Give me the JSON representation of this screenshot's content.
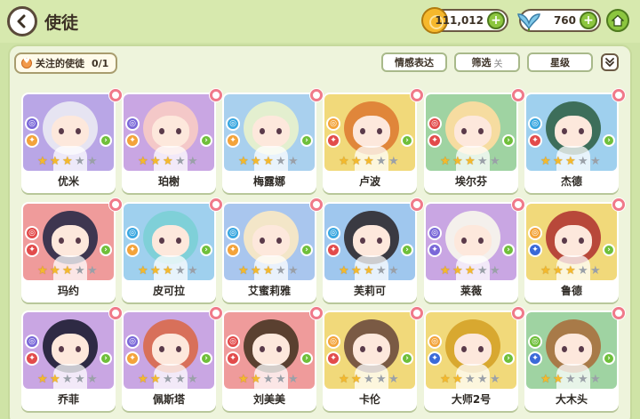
{
  "header": {
    "title": "使徒"
  },
  "currency": {
    "coins": "111,012",
    "gems": "760"
  },
  "toolbar": {
    "follow_label": "关注的使徒",
    "follow_count": "0/1",
    "emotion_label": "情感表达",
    "filter_label": "筛选",
    "filter_state": "关",
    "star_label": "星级"
  },
  "rows": [
    [
      {
        "name": "优米",
        "bg": "#b9a6e6",
        "stars": 3,
        "element": "#7a68d8",
        "role": "#f3a33a",
        "hair": "#e6e4f2"
      },
      {
        "name": "珀榭",
        "bg": "#c9a6e3",
        "stars": 3,
        "element": "#7a68d8",
        "role": "#f3a33a",
        "hair": "#f4c8c8"
      },
      {
        "name": "梅露娜",
        "bg": "#a9d0ee",
        "stars": 3,
        "element": "#3aa7e0",
        "role": "#f3a33a",
        "hair": "#e3efcf"
      },
      {
        "name": "卢波",
        "bg": "#f1d97a",
        "stars": 3,
        "element": "#f3a33a",
        "role": "#e24b4b",
        "hair": "#e0863a"
      },
      {
        "name": "埃尔芬",
        "bg": "#9fd3a2",
        "stars": 3,
        "element": "#e24b4b",
        "role": "#e24b4b",
        "hair": "#f6dca0"
      },
      {
        "name": "杰德",
        "bg": "#9fd0ee",
        "stars": 3,
        "element": "#3aa7e0",
        "role": "#e24b4b",
        "hair": "#3d6e5a"
      }
    ],
    [
      {
        "name": "玛约",
        "bg": "#ef9b9b",
        "stars": 3,
        "element": "#e24b4b",
        "role": "#e24b4b",
        "hair": "#3e3650"
      },
      {
        "name": "皮可拉",
        "bg": "#9fd0ee",
        "stars": 3,
        "element": "#3aa7e0",
        "role": "#f3a33a",
        "hair": "#7fd0d8"
      },
      {
        "name": "艾蜜莉雅",
        "bg": "#a9c6ee",
        "stars": 3,
        "element": "#3aa7e0",
        "role": "#f3a33a",
        "hair": "#f3e6c8"
      },
      {
        "name": "芙莉可",
        "bg": "#9fc7ee",
        "stars": 3,
        "element": "#3aa7e0",
        "role": "#e24b4b",
        "hair": "#3a3a42"
      },
      {
        "name": "莱薇",
        "bg": "#c9a6e3",
        "stars": 3,
        "element": "#7a68d8",
        "role": "#7a68d8",
        "hair": "#f4f0ec"
      },
      {
        "name": "鲁德",
        "bg": "#f1d97a",
        "stars": 3,
        "element": "#f3a33a",
        "role": "#3a6ad8",
        "hair": "#b8483a"
      }
    ],
    [
      {
        "name": "乔菲",
        "bg": "#c9a6e3",
        "stars": 2,
        "element": "#7a68d8",
        "role": "#e24b4b",
        "hair": "#2e2a44"
      },
      {
        "name": "佩斯塔",
        "bg": "#c9a6e3",
        "stars": 2,
        "element": "#7a68d8",
        "role": "#f3a33a",
        "hair": "#d8705a"
      },
      {
        "name": "刘美美",
        "bg": "#ef9b9b",
        "stars": 2,
        "element": "#e24b4b",
        "role": "#e24b4b",
        "hair": "#5a4030"
      },
      {
        "name": "卡伦",
        "bg": "#f1d97a",
        "stars": 2,
        "element": "#f3a33a",
        "role": "#e24b4b",
        "hair": "#7a5a44"
      },
      {
        "name": "大师2号",
        "bg": "#f1d97a",
        "stars": 2,
        "element": "#f3a33a",
        "role": "#3a6ad8",
        "hair": "#d8a830"
      },
      {
        "name": "大木头",
        "bg": "#9fd3a2",
        "stars": 2,
        "element": "#6fbf3a",
        "role": "#3a6ad8",
        "hair": "#a87a48"
      }
    ]
  ]
}
